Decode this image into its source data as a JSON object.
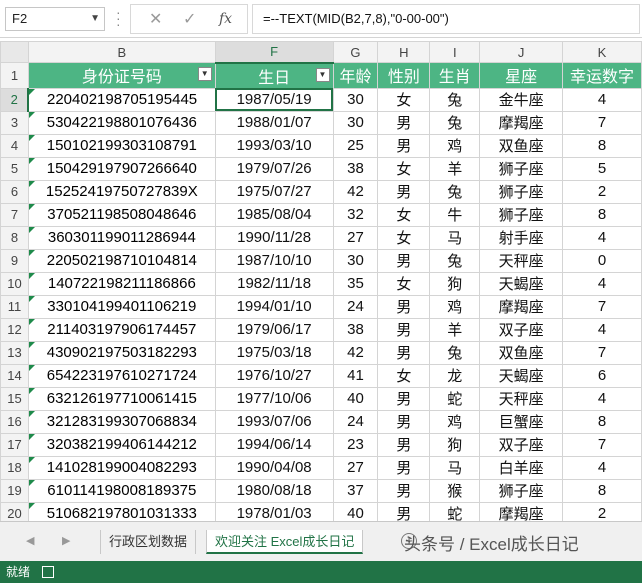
{
  "formula_bar": {
    "name_box": "F2",
    "cancel_symbol": "✕",
    "enter_symbol": "✓",
    "fx_symbol": "fx",
    "formula": "=--TEXT(MID(B2,7,8),\"0-00-00\")"
  },
  "columns": [
    "B",
    "F",
    "G",
    "H",
    "I",
    "J",
    "K"
  ],
  "selected_column": "F",
  "headers": [
    "身份证号码",
    "生日",
    "年龄",
    "性别",
    "生肖",
    "星座",
    "幸运数字"
  ],
  "rows": [
    {
      "n": "2",
      "id": "220402198705195445",
      "birthday": "1987/05/19",
      "age": "30",
      "gender": "女",
      "zodiac": "兔",
      "star": "金牛座",
      "lucky": "4"
    },
    {
      "n": "3",
      "id": "530422198801076436",
      "birthday": "1988/01/07",
      "age": "30",
      "gender": "男",
      "zodiac": "兔",
      "star": "摩羯座",
      "lucky": "7"
    },
    {
      "n": "4",
      "id": "150102199303108791",
      "birthday": "1993/03/10",
      "age": "25",
      "gender": "男",
      "zodiac": "鸡",
      "star": "双鱼座",
      "lucky": "8"
    },
    {
      "n": "5",
      "id": "150429197907266640",
      "birthday": "1979/07/26",
      "age": "38",
      "gender": "女",
      "zodiac": "羊",
      "star": "狮子座",
      "lucky": "5"
    },
    {
      "n": "6",
      "id": "15252419750727839X",
      "birthday": "1975/07/27",
      "age": "42",
      "gender": "男",
      "zodiac": "兔",
      "star": "狮子座",
      "lucky": "2"
    },
    {
      "n": "7",
      "id": "370521198508048646",
      "birthday": "1985/08/04",
      "age": "32",
      "gender": "女",
      "zodiac": "牛",
      "star": "狮子座",
      "lucky": "8"
    },
    {
      "n": "8",
      "id": "360301199011286944",
      "birthday": "1990/11/28",
      "age": "27",
      "gender": "女",
      "zodiac": "马",
      "star": "射手座",
      "lucky": "4"
    },
    {
      "n": "9",
      "id": "220502198710104814",
      "birthday": "1987/10/10",
      "age": "30",
      "gender": "男",
      "zodiac": "兔",
      "star": "天秤座",
      "lucky": "0"
    },
    {
      "n": "10",
      "id": "140722198211186866",
      "birthday": "1982/11/18",
      "age": "35",
      "gender": "女",
      "zodiac": "狗",
      "star": "天蝎座",
      "lucky": "4"
    },
    {
      "n": "11",
      "id": "330104199401106219",
      "birthday": "1994/01/10",
      "age": "24",
      "gender": "男",
      "zodiac": "鸡",
      "star": "摩羯座",
      "lucky": "7"
    },
    {
      "n": "12",
      "id": "211403197906174457",
      "birthday": "1979/06/17",
      "age": "38",
      "gender": "男",
      "zodiac": "羊",
      "star": "双子座",
      "lucky": "4"
    },
    {
      "n": "13",
      "id": "430902197503182293",
      "birthday": "1975/03/18",
      "age": "42",
      "gender": "男",
      "zodiac": "兔",
      "star": "双鱼座",
      "lucky": "7"
    },
    {
      "n": "14",
      "id": "654223197610271724",
      "birthday": "1976/10/27",
      "age": "41",
      "gender": "女",
      "zodiac": "龙",
      "star": "天蝎座",
      "lucky": "6"
    },
    {
      "n": "15",
      "id": "632126197710061415",
      "birthday": "1977/10/06",
      "age": "40",
      "gender": "男",
      "zodiac": "蛇",
      "star": "天秤座",
      "lucky": "4"
    },
    {
      "n": "16",
      "id": "321283199307068834",
      "birthday": "1993/07/06",
      "age": "24",
      "gender": "男",
      "zodiac": "鸡",
      "star": "巨蟹座",
      "lucky": "8"
    },
    {
      "n": "17",
      "id": "320382199406144212",
      "birthday": "1994/06/14",
      "age": "23",
      "gender": "男",
      "zodiac": "狗",
      "star": "双子座",
      "lucky": "7"
    },
    {
      "n": "18",
      "id": "141028199004082293",
      "birthday": "1990/04/08",
      "age": "27",
      "gender": "男",
      "zodiac": "马",
      "star": "白羊座",
      "lucky": "4"
    },
    {
      "n": "19",
      "id": "610114198008189375",
      "birthday": "1980/08/18",
      "age": "37",
      "gender": "男",
      "zodiac": "猴",
      "star": "狮子座",
      "lucky": "8"
    },
    {
      "n": "20",
      "id": "510682197801031333",
      "birthday": "1978/01/03",
      "age": "40",
      "gender": "男",
      "zodiac": "蛇",
      "star": "摩羯座",
      "lucky": "2"
    }
  ],
  "sheet_tabs": [
    "行政区划数据",
    "欢迎关注 Excel成长日记"
  ],
  "active_tab": 1,
  "add_sheet_symbol": "+",
  "watermark": "头条号 / Excel成长日记",
  "status": {
    "ready": "就绪"
  },
  "colors": {
    "accent": "#217346",
    "header_fill": "#4db584"
  }
}
